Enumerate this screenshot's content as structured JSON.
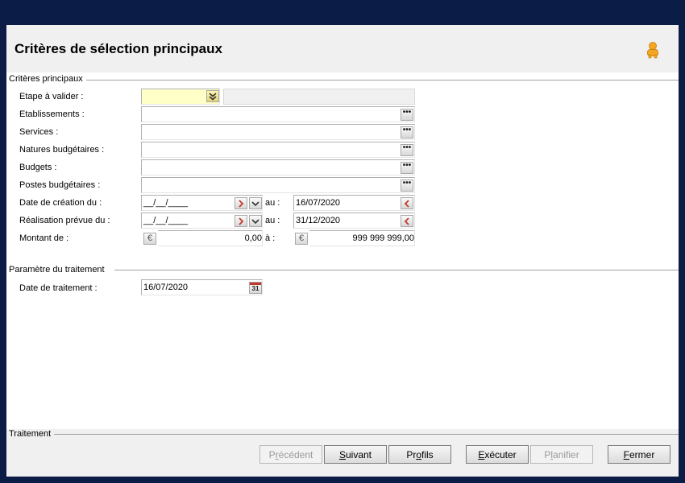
{
  "header": {
    "title": "Critères de sélection principaux"
  },
  "groups": {
    "main_criteria": "Critères principaux",
    "processing_params": "Paramètre du traitement",
    "processing": "Traitement"
  },
  "fields": {
    "etape": {
      "label": "Etape à valider :",
      "value": ""
    },
    "etablissements": {
      "label": "Etablissements :",
      "value": ""
    },
    "services": {
      "label": "Services :",
      "value": ""
    },
    "natures": {
      "label": "Natures budgétaires :",
      "value": ""
    },
    "budgets": {
      "label": "Budgets :",
      "value": ""
    },
    "postes": {
      "label": "Postes budgétaires :",
      "value": ""
    },
    "date_creation": {
      "label": "Date de création du :",
      "from": "__/__/____",
      "au_label": "au :",
      "to": "16/07/2020"
    },
    "realisation": {
      "label": "Réalisation prévue du :",
      "from": "__/__/____",
      "au_label": "au :",
      "to": "31/12/2020"
    },
    "montant": {
      "label": "Montant de :",
      "from": "0,00",
      "a_label": "à :",
      "to": "999 999 999,00"
    },
    "date_traitement": {
      "label": "Date de traitement :",
      "value": "16/07/2020"
    }
  },
  "icons": {
    "ellipsis": "•••",
    "euro": "€",
    "calendar_day": "31",
    "chevron_down": "⌄",
    "double_chevron": "»",
    "arrow_right": "›",
    "arrow_left": "‹"
  },
  "buttons": {
    "precedent": {
      "first": "P",
      "u": "r",
      "rest": "écédent"
    },
    "suivant": {
      "first": "",
      "u": "S",
      "rest": "uivant"
    },
    "profils": {
      "first": "Pr",
      "u": "o",
      "rest": "fils"
    },
    "executer": {
      "first": "",
      "u": "E",
      "rest": "xécuter"
    },
    "planifier": {
      "first": "P",
      "u": "l",
      "rest": "anifier"
    },
    "fermer": {
      "first": "",
      "u": "F",
      "rest": "ermer"
    }
  },
  "colors": {
    "background": "#0b1c47",
    "header": "#f0f0f0",
    "required_field": "#ffffc8"
  }
}
